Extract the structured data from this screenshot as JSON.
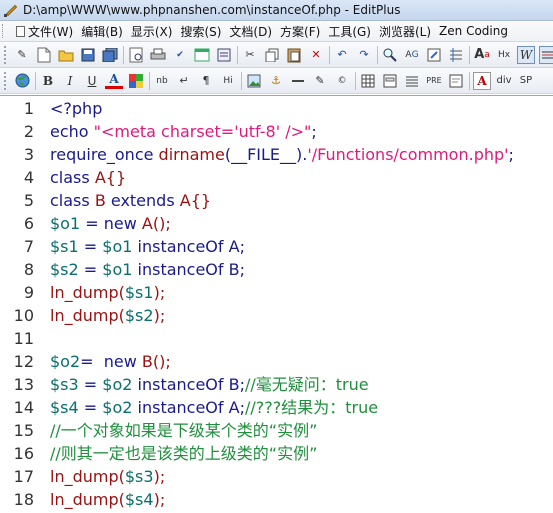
{
  "window": {
    "title": "D:\\amp\\WWW\\www.phpnanshen.com\\instanceOf.php - EditPlus"
  },
  "menu": [
    {
      "label": "文件(W)"
    },
    {
      "label": "编辑(B)"
    },
    {
      "label": "显示(X)"
    },
    {
      "label": "搜索(S)"
    },
    {
      "label": "文档(D)"
    },
    {
      "label": "方案(F)"
    },
    {
      "label": "工具(G)"
    },
    {
      "label": "浏览器(L)"
    },
    {
      "label": "Zen Coding"
    }
  ],
  "toolbar2": {
    "bold": "B",
    "italic": "I",
    "underline": "U",
    "font_color": "A",
    "nb": "nb",
    "br": "↵",
    "para": "¶",
    "hi": "Hi",
    "pre": "PRE",
    "div": "div",
    "sp": "SP",
    "hx": "Hx"
  },
  "editor": {
    "lines": [
      {
        "n": "1",
        "tokens": [
          {
            "t": "<?php",
            "c": "kw"
          }
        ]
      },
      {
        "n": "2",
        "tokens": [
          {
            "t": "echo ",
            "c": "kw"
          },
          {
            "t": "\"<meta charset='utf-8' />\"",
            "c": "str"
          },
          {
            "t": ";",
            "c": "kw"
          }
        ]
      },
      {
        "n": "3",
        "tokens": [
          {
            "t": "require_once ",
            "c": "kw"
          },
          {
            "t": "dirname",
            "c": "fn"
          },
          {
            "t": "(__FILE__).",
            "c": "kw"
          },
          {
            "t": "'/Functions/common.php'",
            "c": "str"
          },
          {
            "t": ";",
            "c": "kw"
          }
        ]
      },
      {
        "n": "4",
        "tokens": [
          {
            "t": "class ",
            "c": "kw"
          },
          {
            "t": "A{}",
            "c": "fn"
          }
        ]
      },
      {
        "n": "5",
        "tokens": [
          {
            "t": "class ",
            "c": "kw"
          },
          {
            "t": "B ",
            "c": "fn"
          },
          {
            "t": "extends ",
            "c": "kw"
          },
          {
            "t": "A{}",
            "c": "fn"
          }
        ]
      },
      {
        "n": "6",
        "tokens": [
          {
            "t": "$o1",
            "c": "var"
          },
          {
            "t": " = ",
            "c": "kw"
          },
          {
            "t": "new ",
            "c": "kw"
          },
          {
            "t": "A();",
            "c": "fn"
          }
        ]
      },
      {
        "n": "7",
        "tokens": [
          {
            "t": "$s1",
            "c": "var"
          },
          {
            "t": " = ",
            "c": "kw"
          },
          {
            "t": "$o1",
            "c": "var"
          },
          {
            "t": " instanceOf A;",
            "c": "kw"
          }
        ]
      },
      {
        "n": "8",
        "tokens": [
          {
            "t": "$s2",
            "c": "var"
          },
          {
            "t": " = ",
            "c": "kw"
          },
          {
            "t": "$o1",
            "c": "var"
          },
          {
            "t": " instanceOf B;",
            "c": "kw"
          }
        ]
      },
      {
        "n": "9",
        "tokens": [
          {
            "t": "ln_dump(",
            "c": "fn"
          },
          {
            "t": "$s1",
            "c": "var"
          },
          {
            "t": ");",
            "c": "fn"
          }
        ]
      },
      {
        "n": "10",
        "tokens": [
          {
            "t": "ln_dump(",
            "c": "fn"
          },
          {
            "t": "$s2",
            "c": "var"
          },
          {
            "t": ");",
            "c": "fn"
          }
        ]
      },
      {
        "n": "11",
        "tokens": []
      },
      {
        "n": "12",
        "tokens": [
          {
            "t": "$o2",
            "c": "var"
          },
          {
            "t": "=  ",
            "c": "kw"
          },
          {
            "t": "new ",
            "c": "kw"
          },
          {
            "t": "B();",
            "c": "fn"
          }
        ]
      },
      {
        "n": "13",
        "tokens": [
          {
            "t": "$s3",
            "c": "var"
          },
          {
            "t": " = ",
            "c": "kw"
          },
          {
            "t": "$o2",
            "c": "var"
          },
          {
            "t": " instanceOf B;",
            "c": "kw"
          },
          {
            "t": "//毫无疑问：true",
            "c": "cm"
          }
        ]
      },
      {
        "n": "14",
        "tokens": [
          {
            "t": "$s4",
            "c": "var"
          },
          {
            "t": " = ",
            "c": "kw"
          },
          {
            "t": "$o2",
            "c": "var"
          },
          {
            "t": " instanceOf A;",
            "c": "kw"
          },
          {
            "t": "//???结果为：true",
            "c": "cm"
          }
        ]
      },
      {
        "n": "15",
        "tokens": [
          {
            "t": "//一个对象如果是下级某个类的“实例”",
            "c": "cm"
          }
        ]
      },
      {
        "n": "16",
        "tokens": [
          {
            "t": "//则其一定也是该类的上级类的“实例”",
            "c": "cm"
          }
        ]
      },
      {
        "n": "17",
        "tokens": [
          {
            "t": "ln_dump(",
            "c": "fn"
          },
          {
            "t": "$s3",
            "c": "var"
          },
          {
            "t": ");",
            "c": "fn"
          }
        ]
      },
      {
        "n": "18",
        "tokens": [
          {
            "t": "ln_dump(",
            "c": "fn"
          },
          {
            "t": "$s4",
            "c": "var"
          },
          {
            "t": ");",
            "c": "fn"
          }
        ]
      }
    ]
  }
}
